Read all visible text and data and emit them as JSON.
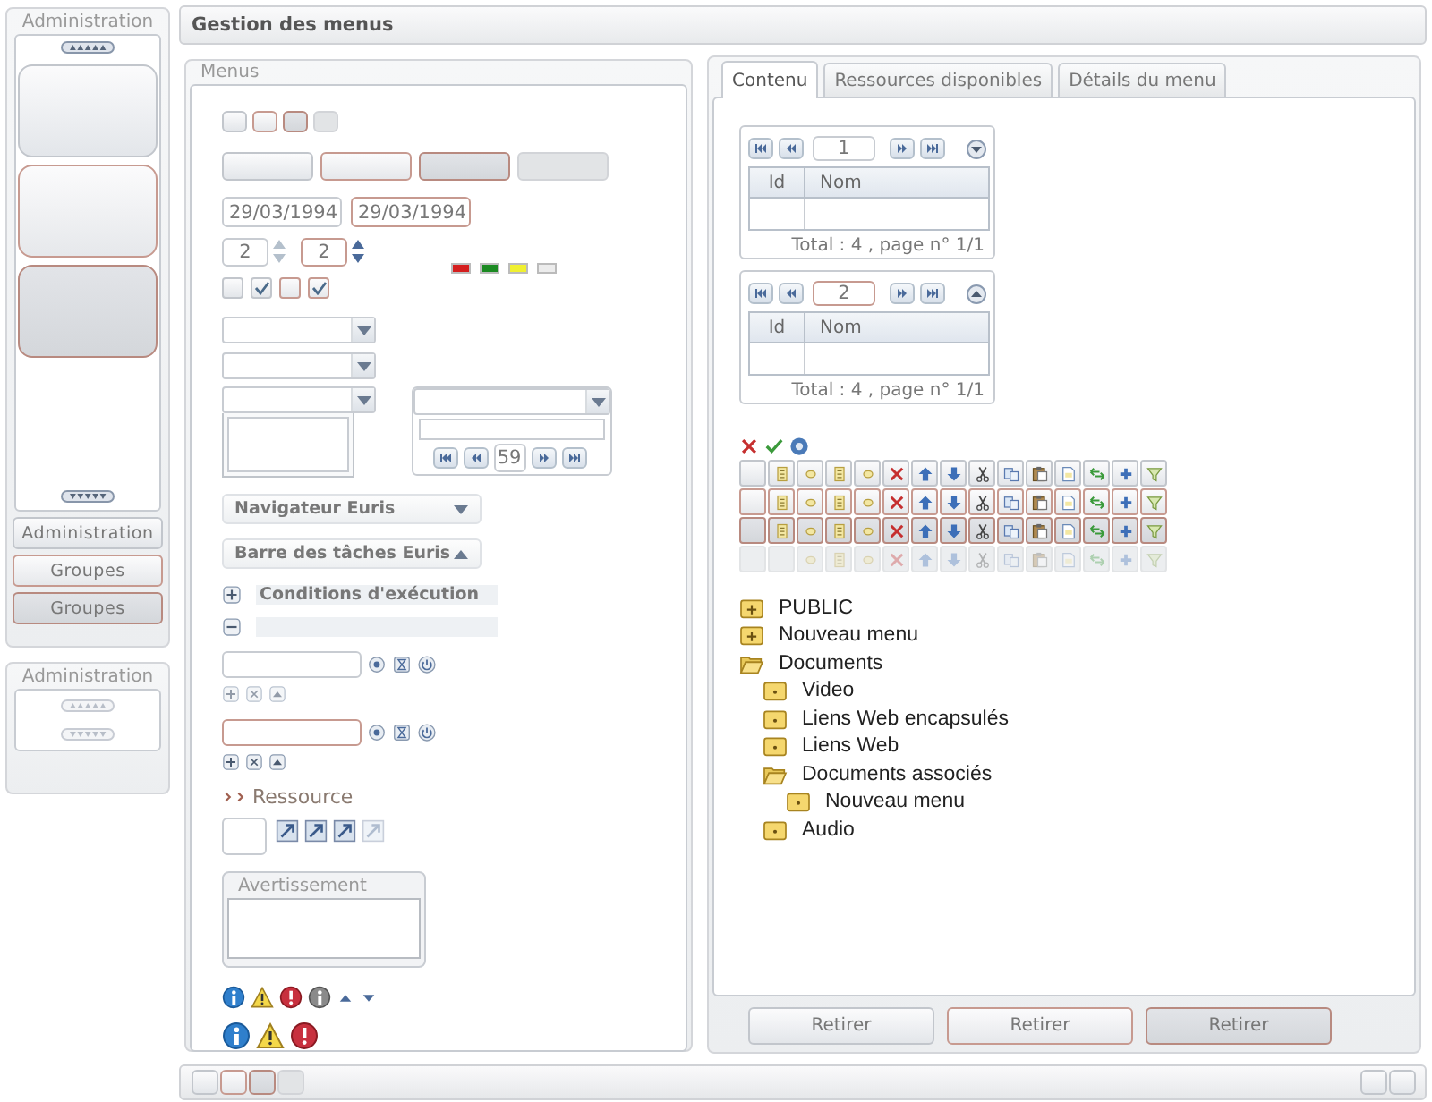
{
  "sidebar": {
    "title": "Administration",
    "tiles": [
      {
        "kind": "normal"
      },
      {
        "kind": "hover"
      },
      {
        "kind": "pressed"
      }
    ],
    "buttons": [
      {
        "label": "Administration",
        "kind": "normal"
      },
      {
        "label": "Groupes",
        "kind": "hover"
      },
      {
        "label": "Groupes",
        "kind": "pressed"
      }
    ]
  },
  "sidebar_2": {
    "title": "Administration"
  },
  "header": {
    "title": "Gestion des menus"
  },
  "menus": {
    "title": "Menus",
    "small_buttons": [
      {
        "kind": "normal"
      },
      {
        "kind": "hover"
      },
      {
        "kind": "pressed"
      },
      {
        "kind": "disabled"
      }
    ],
    "buttons": [
      {
        "kind": "normal"
      },
      {
        "kind": "hover"
      },
      {
        "kind": "pressed"
      },
      {
        "kind": "disabled"
      }
    ],
    "dates": [
      {
        "value": "29/03/1994",
        "kind": "normal"
      },
      {
        "value": "29/03/1994",
        "kind": "hover"
      }
    ],
    "spinners": [
      {
        "value": "2",
        "kind": "normal"
      },
      {
        "value": "2",
        "kind": "hover"
      }
    ],
    "swatches": [
      {
        "color": "#d41e1e"
      },
      {
        "color": "#1b8a22"
      },
      {
        "color": "#f0f030"
      },
      {
        "color": "#ececec"
      }
    ],
    "checkboxes": [
      {
        "checked": false,
        "kind": "normal"
      },
      {
        "checked": true,
        "kind": "normal"
      },
      {
        "checked": false,
        "kind": "hover"
      },
      {
        "checked": true,
        "kind": "hover"
      }
    ],
    "pager": {
      "value": "59"
    },
    "accordions": [
      {
        "label": "Navigateur Euris",
        "expanded": false
      },
      {
        "label": "Barre des tâches Euris",
        "expanded": true
      }
    ],
    "sections": [
      {
        "label": "Conditions d'exécution",
        "expanded": false
      },
      {
        "expanded": true
      }
    ],
    "fields": [
      {
        "kind": "normal"
      },
      {
        "kind": "hover"
      }
    ],
    "link": "Ressource",
    "group": {
      "title": "Avertissement"
    }
  },
  "content": {
    "tabs": [
      {
        "label": "Contenu",
        "selected": true
      },
      {
        "label": "Ressources disponibles",
        "selected": false
      },
      {
        "label": "Détails du menu",
        "selected": false
      }
    ],
    "grids": [
      {
        "page": "1",
        "kind": "normal",
        "expanded": false,
        "columns": [
          "Id",
          "Nom"
        ],
        "footer": "Total : 4 , page n° 1/1"
      },
      {
        "page": "2",
        "kind": "hover",
        "expanded": true,
        "columns": [
          "Id",
          "Nom"
        ],
        "footer": "Total : 4 , page n° 1/1"
      }
    ],
    "toolbar_rows": [
      {
        "kind": "normal"
      },
      {
        "kind": "hover"
      },
      {
        "kind": "pressed"
      },
      {
        "kind": "disabled"
      }
    ],
    "tree": [
      {
        "label": "PUBLIC",
        "kind": "branch",
        "expanded": false
      },
      {
        "label": "Nouveau menu",
        "kind": "branch",
        "expanded": false
      },
      {
        "label": "Documents",
        "kind": "branch",
        "expanded": true,
        "children": [
          {
            "label": "Video",
            "kind": "leaf"
          },
          {
            "label": "Liens Web encapsulés",
            "kind": "leaf"
          },
          {
            "label": "Liens Web",
            "kind": "leaf"
          },
          {
            "label": "Documents associés",
            "kind": "branch",
            "expanded": true,
            "children": [
              {
                "label": "Nouveau menu",
                "kind": "leaf"
              }
            ]
          },
          {
            "label": "Audio",
            "kind": "leaf"
          }
        ]
      }
    ],
    "actions": [
      {
        "label": "Retirer",
        "kind": "normal"
      },
      {
        "label": "Retirer",
        "kind": "hover"
      },
      {
        "label": "Retirer",
        "kind": "pressed"
      }
    ]
  },
  "taskbar": {
    "left": [
      {
        "kind": "normal"
      },
      {
        "kind": "hover"
      },
      {
        "kind": "pressed"
      },
      {
        "kind": "disabled"
      }
    ],
    "right": [
      {
        "kind": "normal"
      },
      {
        "kind": "normal"
      }
    ]
  }
}
